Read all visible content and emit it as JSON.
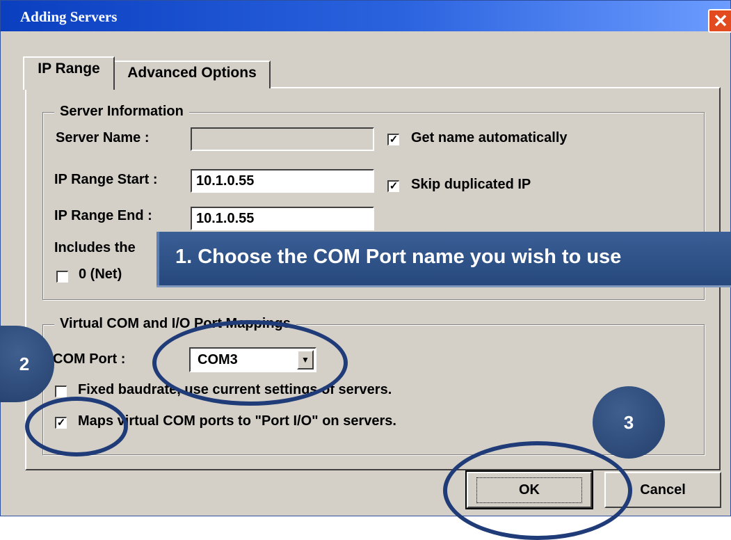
{
  "window": {
    "title": "Adding Servers",
    "close_symbol": "✕"
  },
  "tabs": [
    {
      "label": "IP Range",
      "active": true
    },
    {
      "label": "Advanced Options",
      "active": false
    }
  ],
  "server_info": {
    "legend": "Server Information",
    "server_name_label": "Server Name :",
    "server_name_value": "",
    "get_name_auto_label": "Get name automatically",
    "get_name_auto_checked": true,
    "ip_start_label": "IP Range Start :",
    "ip_start_value": "10.1.0.55",
    "skip_dup_label": "Skip duplicated IP",
    "skip_dup_checked": true,
    "ip_end_label": "IP Range End :",
    "ip_end_value": "10.1.0.55",
    "includes_label": "Includes the",
    "net_label": "0 (Net)",
    "net_checked": false
  },
  "mapping": {
    "legend": "Virtual COM and I/O Port Mappings",
    "com_port_label": "COM Port :",
    "com_port_value": "COM3",
    "fixed_baud_label": "Fixed baudrate, use current settings of servers.",
    "fixed_baud_checked": false,
    "maps_label": "Maps virtual COM ports to \"Port I/O\" on servers.",
    "maps_checked": true
  },
  "buttons": {
    "ok": "OK",
    "cancel": "Cancel"
  },
  "annotations": {
    "callout_1": "1. Choose the COM Port name you wish to use",
    "badge_2": "2",
    "badge_3": "3",
    "accent_color": "#26487c"
  },
  "check_symbol": "✓"
}
